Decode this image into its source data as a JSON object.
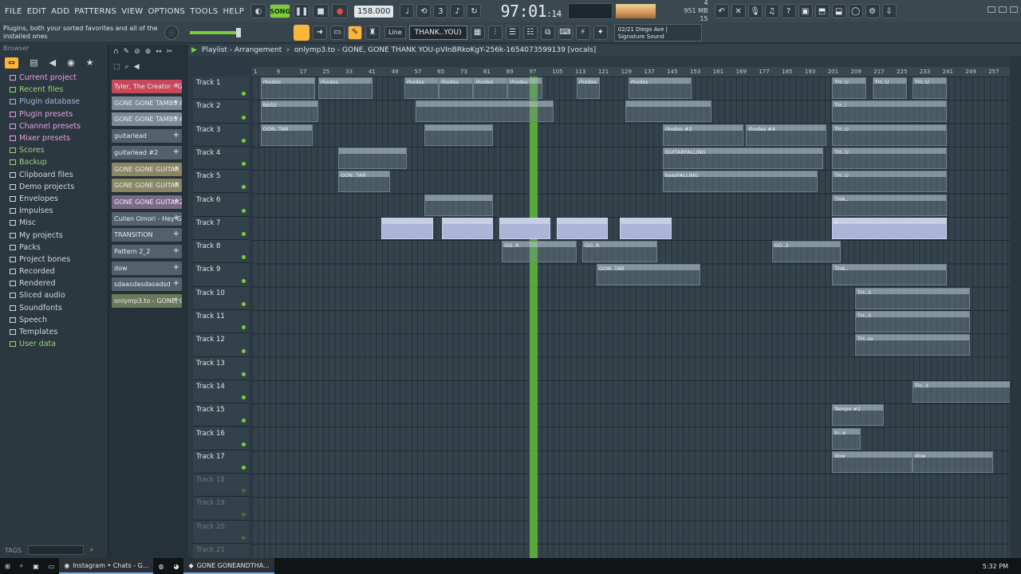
{
  "menu": [
    "FILE",
    "EDIT",
    "ADD",
    "PATTERNS",
    "VIEW",
    "OPTIONS",
    "TOOLS",
    "HELP"
  ],
  "transport": {
    "mode": "SONG",
    "tempo": "158.000",
    "time_main": "97:01",
    "time_sub": ":14",
    "cpu_line1": "951 MB",
    "cpu_line2": "15",
    "cpu_top": "4"
  },
  "hint": "Plugins, both your sorted favorites and all of the installed ones",
  "snap_select": "Line",
  "pattern_select": "THANK..YOU)",
  "news": {
    "line1": "02/21 Diego Ave |",
    "line2": "Signature Sound"
  },
  "browser": {
    "title": "Browser",
    "items": [
      {
        "label": "Current project",
        "color": "#e7a0e2"
      },
      {
        "label": "Recent files",
        "color": "#9ad27a"
      },
      {
        "label": "Plugin database",
        "color": "#9ab9e2"
      },
      {
        "label": "Plugin presets",
        "color": "#e2a0e2"
      },
      {
        "label": "Channel presets",
        "color": "#e2a0e2"
      },
      {
        "label": "Mixer presets",
        "color": "#e2a0e2"
      },
      {
        "label": "Scores",
        "color": "#9ad27a"
      },
      {
        "label": "Backup",
        "color": "#9ad27a"
      },
      {
        "label": "Clipboard files",
        "color": "#cfd8dc"
      },
      {
        "label": "Demo projects",
        "color": "#cfd8dc"
      },
      {
        "label": "Envelopes",
        "color": "#cfd8dc"
      },
      {
        "label": "Impulses",
        "color": "#cfd8dc"
      },
      {
        "label": "Misc",
        "color": "#cfd8dc"
      },
      {
        "label": "My projects",
        "color": "#cfd8dc"
      },
      {
        "label": "Packs",
        "color": "#cfd8dc"
      },
      {
        "label": "Project bones",
        "color": "#cfd8dc"
      },
      {
        "label": "Recorded",
        "color": "#cfd8dc"
      },
      {
        "label": "Rendered",
        "color": "#cfd8dc"
      },
      {
        "label": "Sliced audio",
        "color": "#cfd8dc"
      },
      {
        "label": "Soundfonts",
        "color": "#cfd8dc"
      },
      {
        "label": "Speech",
        "color": "#cfd8dc"
      },
      {
        "label": "Templates",
        "color": "#cfd8dc"
      },
      {
        "label": "User data",
        "color": "#9ad27a"
      }
    ],
    "tags_label": "TAGS"
  },
  "channels": [
    {
      "label": "Tyler, The Creator - G...",
      "color": "#c8485a"
    },
    {
      "label": "GONE GONE TAMBS A...",
      "color": "#7a8a96"
    },
    {
      "label": "GONE GONE TAMBS A...",
      "color": "#7a8a96"
    },
    {
      "label": "guitarlead",
      "color": "#52616b"
    },
    {
      "label": "guitarlead #2",
      "color": "#52616b"
    },
    {
      "label": "GONE GONE GUITAR",
      "color": "#8a8562"
    },
    {
      "label": "GONE GONE GUITAR #2",
      "color": "#8a8562"
    },
    {
      "label": "GONE GONE GUITAR2",
      "color": "#7a6a8a"
    },
    {
      "label": "Cullen Omori - Hey G...",
      "color": "#52616b"
    },
    {
      "label": "TRANSITION",
      "color": "#52616b"
    },
    {
      "label": "Pattern 2_2",
      "color": "#52616b"
    },
    {
      "label": "dow",
      "color": "#52616b"
    },
    {
      "label": "sdaasdasdasadsd",
      "color": "#52616b"
    },
    {
      "label": "onlymp3.to - GONE, GON",
      "color": "#6a7a58"
    }
  ],
  "playlist": {
    "title": "Playlist - Arrangement",
    "pattern": "onlymp3.to - GONE, GONE  THANK YOU-pVInBRkoKgY-256k-1654073599139 [vocals]",
    "ruler": [
      "1",
      "9",
      "17",
      "25",
      "33",
      "41",
      "49",
      "57",
      "65",
      "73",
      "81",
      "89",
      "97",
      "105",
      "113",
      "121",
      "129",
      "137",
      "145",
      "153",
      "161",
      "169",
      "177",
      "185",
      "193",
      "201",
      "209",
      "217",
      "225",
      "233",
      "241",
      "249",
      "257"
    ],
    "tracks": [
      "Track 1",
      "Track 2",
      "Track 3",
      "Track 4",
      "Track 5",
      "Track 6",
      "Track 7",
      "Track 8",
      "Track 9",
      "Track 10",
      "Track 11",
      "Track 12",
      "Track 13",
      "Track 14",
      "Track 15",
      "Track 16",
      "Track 17",
      "Track 18",
      "Track 19",
      "Track 20",
      "Track 21"
    ]
  },
  "clips": [
    {
      "track": 0,
      "start": 3,
      "len": 19,
      "label": "rhodes"
    },
    {
      "track": 0,
      "start": 23,
      "len": 19,
      "label": "rhodes"
    },
    {
      "track": 0,
      "start": 53,
      "len": 12,
      "label": "rhodes"
    },
    {
      "track": 0,
      "start": 65,
      "len": 12,
      "label": "rhodes"
    },
    {
      "track": 0,
      "start": 77,
      "len": 12,
      "label": "rhodes"
    },
    {
      "track": 0,
      "start": 89,
      "len": 12,
      "label": "rhodes"
    },
    {
      "track": 0,
      "start": 113,
      "len": 8,
      "label": "rhodes"
    },
    {
      "track": 0,
      "start": 131,
      "len": 22,
      "label": "rhodes"
    },
    {
      "track": 0,
      "start": 202,
      "len": 12,
      "label": "TH..U"
    },
    {
      "track": 0,
      "start": 216,
      "len": 12,
      "label": "TH..U"
    },
    {
      "track": 0,
      "start": 230,
      "len": 12,
      "label": "TH..U"
    },
    {
      "track": 1,
      "start": 3,
      "len": 20,
      "label": "BASS"
    },
    {
      "track": 1,
      "start": 57,
      "len": 48,
      "label": ""
    },
    {
      "track": 1,
      "start": 130,
      "len": 30,
      "label": ""
    },
    {
      "track": 1,
      "start": 202,
      "len": 40,
      "label": "TH..I"
    },
    {
      "track": 2,
      "start": 3,
      "len": 18,
      "label": "GON..TAR"
    },
    {
      "track": 2,
      "start": 60,
      "len": 24,
      "label": ""
    },
    {
      "track": 2,
      "start": 143,
      "len": 28,
      "label": "rhodes #2"
    },
    {
      "track": 2,
      "start": 172,
      "len": 28,
      "label": "rhodes #4"
    },
    {
      "track": 2,
      "start": 202,
      "len": 40,
      "label": "TH..U"
    },
    {
      "track": 3,
      "start": 30,
      "len": 24,
      "label": ""
    },
    {
      "track": 3,
      "start": 143,
      "len": 56,
      "label": "GUITARFALLING"
    },
    {
      "track": 3,
      "start": 202,
      "len": 40,
      "label": "TH..U"
    },
    {
      "track": 4,
      "start": 30,
      "len": 18,
      "label": "GON..TAR"
    },
    {
      "track": 4,
      "start": 143,
      "len": 54,
      "label": "bassFALLING"
    },
    {
      "track": 4,
      "start": 202,
      "len": 40,
      "label": "TH..U"
    },
    {
      "track": 5,
      "start": 60,
      "len": 24,
      "label": ""
    },
    {
      "track": 5,
      "start": 202,
      "len": 40,
      "label": "THA.."
    },
    {
      "track": 6,
      "start": 45,
      "len": 18,
      "label": ""
    },
    {
      "track": 6,
      "start": 66,
      "len": 18,
      "label": ""
    },
    {
      "track": 6,
      "start": 86,
      "len": 18,
      "label": ""
    },
    {
      "track": 6,
      "start": 106,
      "len": 18,
      "label": ""
    },
    {
      "track": 6,
      "start": 128,
      "len": 18,
      "label": ""
    },
    {
      "track": 6,
      "start": 202,
      "len": 40,
      "label": "e"
    },
    {
      "track": 7,
      "start": 87,
      "len": 26,
      "label": "GO..R"
    },
    {
      "track": 7,
      "start": 115,
      "len": 26,
      "label": "GO..R"
    },
    {
      "track": 7,
      "start": 181,
      "len": 24,
      "label": "GO..2"
    },
    {
      "track": 8,
      "start": 120,
      "len": 36,
      "label": "GON..TAR"
    },
    {
      "track": 8,
      "start": 202,
      "len": 40,
      "label": "THA.."
    },
    {
      "track": 9,
      "start": 210,
      "len": 40,
      "label": "TH..3"
    },
    {
      "track": 10,
      "start": 210,
      "len": 40,
      "label": "TH..3"
    },
    {
      "track": 11,
      "start": 210,
      "len": 40,
      "label": "TH..ss"
    },
    {
      "track": 13,
      "start": 230,
      "len": 40,
      "label": "TH..3"
    },
    {
      "track": 14,
      "start": 202,
      "len": 18,
      "label": "Tempo #2"
    },
    {
      "track": 15,
      "start": 202,
      "len": 10,
      "label": "In..e"
    },
    {
      "track": 16,
      "start": 202,
      "len": 28,
      "label": "dow"
    },
    {
      "track": 16,
      "start": 230,
      "len": 28,
      "label": "dow"
    }
  ],
  "taskbar": {
    "items": [
      "Instagram • Chats - G...",
      "GONE GONEANDTHA..."
    ],
    "clock": "5:32 PM"
  }
}
